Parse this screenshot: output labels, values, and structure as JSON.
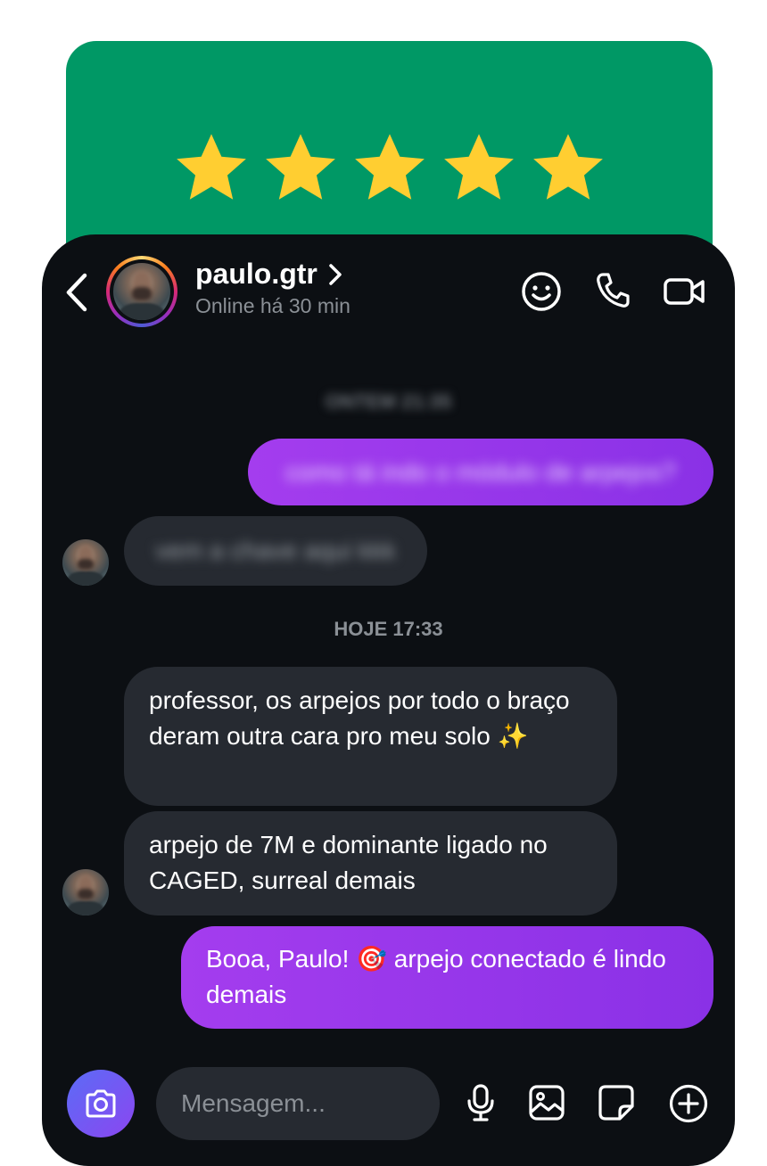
{
  "rating": {
    "stars": 5,
    "max": 5,
    "star_color": "#FFCE31",
    "card_color": "#009865"
  },
  "header": {
    "username": "paulo.gtr",
    "status": "Online há 30 min",
    "icons": [
      "back-arrow-icon",
      "avatar",
      "chevron-right-icon",
      "smiley-icon",
      "phone-icon",
      "video-camera-icon"
    ]
  },
  "thread": {
    "earlier_timestamp": "ONTEM 21:35",
    "earlier_outgoing": "como tá indo o módulo de arpejos?",
    "earlier_incoming": "vem a chave aqui kkk",
    "today_timestamp": "HOJE 17:33",
    "incoming_1": "professor, os arpejos por todo o braço deram outra cara pro meu solo ✨",
    "incoming_2": "arpejo de 7M e dominante ligado no CAGED, surreal demais",
    "outgoing_reply": "Booa, Paulo! 🎯 arpejo conectado é lindo demais"
  },
  "composer": {
    "placeholder": "Mensagem...",
    "icons": [
      "camera-icon",
      "microphone-icon",
      "gallery-icon",
      "sticker-icon",
      "plus-icon"
    ]
  },
  "colors": {
    "background": "#0c0f13",
    "incoming_bubble": "#262a31",
    "outgoing_bubble": "#9b38ec"
  }
}
